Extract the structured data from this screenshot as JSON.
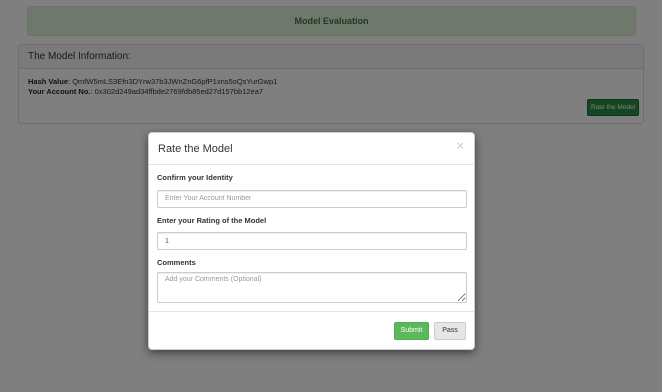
{
  "header": {
    "alert_text": "Model Evaluation"
  },
  "info_panel": {
    "title": "The Model Information:",
    "hash_label": "Hash Value",
    "hash_value": ": QmfW5mLS3Efn3DYrw37b3JWnZnG6pfP1xns5oQsYurGwp1",
    "account_label": "Your Account No.",
    "account_value": ": 0x302d249ad34ffbde2769fdb85ed27d157bb12ea7",
    "rate_button": "Rate the Model"
  },
  "modal": {
    "title": "Rate the Model",
    "close_glyph": "×",
    "identity_label": "Confirm your Identity",
    "identity_placeholder": "Enter Your Account Number",
    "identity_value": "",
    "rating_label": "Enter your Rating of the Model",
    "rating_value": "1",
    "comments_label": "Comments",
    "comments_placeholder": "Add your Comments (Optional)",
    "submit_label": "Submit",
    "pass_label": "Pass"
  },
  "colors": {
    "alert_bg": "#dff0d8",
    "rate_button_bg": "#2a8a43",
    "submit_bg": "#5cb85c",
    "pass_bg": "#e6e6e6"
  }
}
